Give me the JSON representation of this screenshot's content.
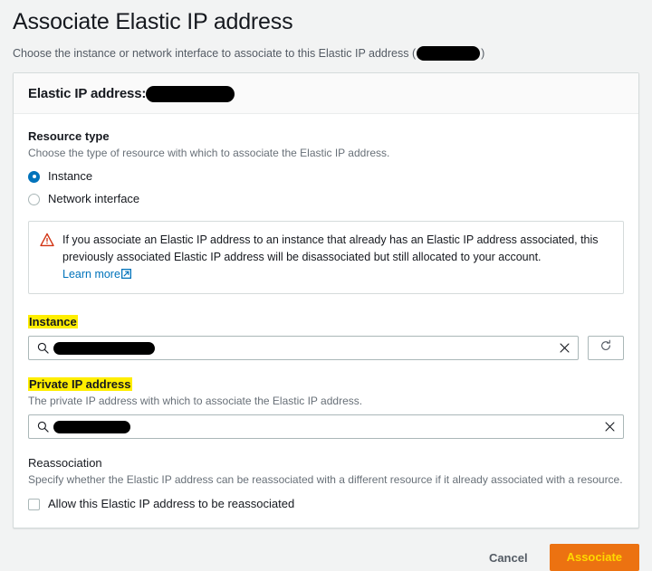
{
  "page": {
    "title": "Associate Elastic IP address",
    "description_before": "Choose the instance or network interface to associate to this Elastic IP address (",
    "description_after": ")"
  },
  "card": {
    "header_label": "Elastic IP address:"
  },
  "resource_type": {
    "label": "Resource type",
    "description": "Choose the type of resource with which to associate the Elastic IP address.",
    "options": [
      {
        "label": "Instance",
        "selected": true
      },
      {
        "label": "Network interface",
        "selected": false
      }
    ]
  },
  "alert": {
    "icon": "warning-triangle-icon",
    "text": "If you associate an Elastic IP address to an instance that already has an Elastic IP address associated, this previously associated Elastic IP address will be disassociated but still allocated to your account.",
    "link_label": "Learn more",
    "link_icon": "external-link-icon",
    "icon_color": "#d13212"
  },
  "instance_field": {
    "label": "Instance",
    "highlighted": true,
    "search_icon": "search-icon",
    "clear_icon": "close-icon",
    "refresh_icon": "refresh-icon",
    "value_redacted": true
  },
  "private_ip_field": {
    "label": "Private IP address",
    "highlighted": true,
    "description": "The private IP address with which to associate the Elastic IP address.",
    "search_icon": "search-icon",
    "clear_icon": "close-icon",
    "value_redacted": true
  },
  "reassociation": {
    "label": "Reassociation",
    "description": "Specify whether the Elastic IP address can be reassociated with a different resource if it already associated with a resource.",
    "checkbox_label": "Allow this Elastic IP address to be reassociated",
    "checked": false
  },
  "footer": {
    "cancel_label": "Cancel",
    "submit_label": "Associate",
    "submit_bg": "#ec7211",
    "submit_fg": "#ffd900"
  },
  "colors": {
    "page_bg": "#f2f3f3",
    "card_bg": "#ffffff",
    "link": "#0073bb",
    "highlight": "#ffee00",
    "radio_selected": "#0073bb"
  }
}
